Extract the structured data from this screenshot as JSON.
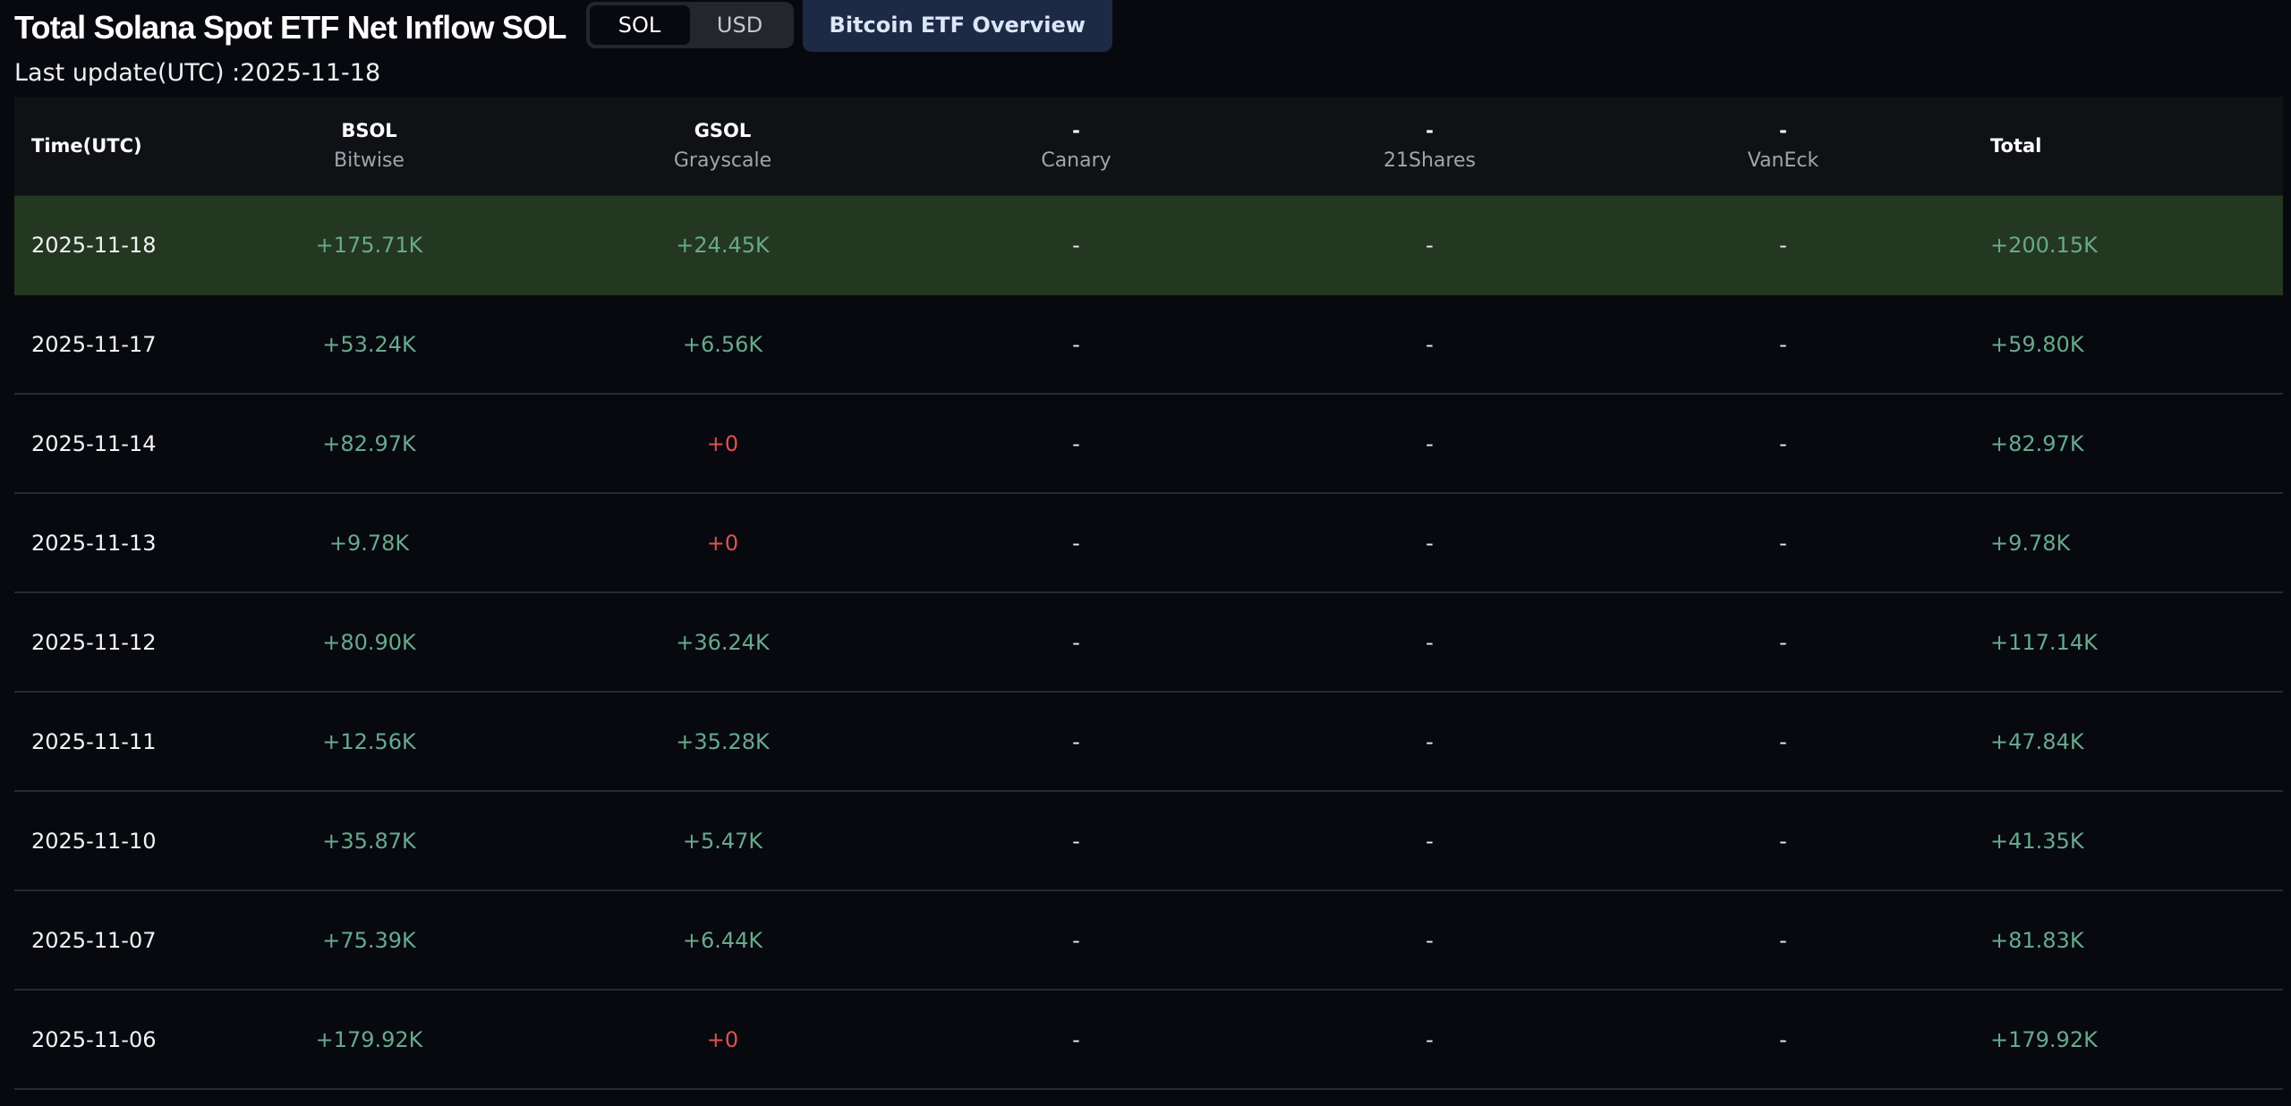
{
  "header": {
    "title": "Total Solana Spot ETF Net Inflow SOL",
    "toggle": {
      "sol": "SOL",
      "usd": "USD",
      "selected": "SOL"
    },
    "overview_button": "Bitcoin ETF Overview"
  },
  "last_update": "Last update(UTC) :2025-11-18",
  "colors": {
    "background": "#07090e",
    "positive": "#67a98d",
    "zero": "#e0504f",
    "highlight_row": "#243720",
    "accent_button": "#1c2a45"
  },
  "table": {
    "columns": [
      {
        "ticker": "Time(UTC)",
        "issuer": ""
      },
      {
        "ticker": "BSOL",
        "issuer": "Bitwise"
      },
      {
        "ticker": "GSOL",
        "issuer": "Grayscale"
      },
      {
        "ticker": "-",
        "issuer": "Canary"
      },
      {
        "ticker": "-",
        "issuer": "21Shares"
      },
      {
        "ticker": "-",
        "issuer": "VanEck"
      },
      {
        "ticker": "Total",
        "issuer": ""
      }
    ],
    "rows": [
      {
        "date": "2025-11-18",
        "bsol": "+175.71K",
        "gsol": "+24.45K",
        "canary": "-",
        "shares21": "-",
        "vaneck": "-",
        "total": "+200.15K"
      },
      {
        "date": "2025-11-17",
        "bsol": "+53.24K",
        "gsol": "+6.56K",
        "canary": "-",
        "shares21": "-",
        "vaneck": "-",
        "total": "+59.80K"
      },
      {
        "date": "2025-11-14",
        "bsol": "+82.97K",
        "gsol": "+0",
        "canary": "-",
        "shares21": "-",
        "vaneck": "-",
        "total": "+82.97K"
      },
      {
        "date": "2025-11-13",
        "bsol": "+9.78K",
        "gsol": "+0",
        "canary": "-",
        "shares21": "-",
        "vaneck": "-",
        "total": "+9.78K"
      },
      {
        "date": "2025-11-12",
        "bsol": "+80.90K",
        "gsol": "+36.24K",
        "canary": "-",
        "shares21": "-",
        "vaneck": "-",
        "total": "+117.14K"
      },
      {
        "date": "2025-11-11",
        "bsol": "+12.56K",
        "gsol": "+35.28K",
        "canary": "-",
        "shares21": "-",
        "vaneck": "-",
        "total": "+47.84K"
      },
      {
        "date": "2025-11-10",
        "bsol": "+35.87K",
        "gsol": "+5.47K",
        "canary": "-",
        "shares21": "-",
        "vaneck": "-",
        "total": "+41.35K"
      },
      {
        "date": "2025-11-07",
        "bsol": "+75.39K",
        "gsol": "+6.44K",
        "canary": "-",
        "shares21": "-",
        "vaneck": "-",
        "total": "+81.83K"
      },
      {
        "date": "2025-11-06",
        "bsol": "+179.92K",
        "gsol": "+0",
        "canary": "-",
        "shares21": "-",
        "vaneck": "-",
        "total": "+179.92K"
      }
    ]
  }
}
